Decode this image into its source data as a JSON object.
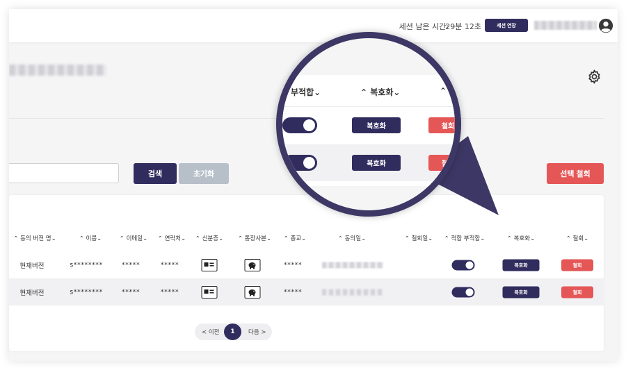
{
  "topbar": {
    "session_label": "세션 남은 시간:",
    "session_time": "29분 12초",
    "extend_label": "세션 연장",
    "user_icon": "user-icon"
  },
  "filters": {
    "search_placeholder": "",
    "search_label": "검색",
    "reset_label": "초기화",
    "bulk_withdraw_label": "선택 철회"
  },
  "table": {
    "headers": [
      "동의 버전 명",
      "이름",
      "이메일",
      "연락처",
      "신분증",
      "통장사본",
      "종교",
      "동의일",
      "철회일",
      "적합 부적합",
      "복호화",
      "철회"
    ],
    "rows": [
      {
        "version": "현재버전",
        "name": "s********",
        "email": "*****",
        "phone": "*****",
        "religion": "*****",
        "consent_on": true,
        "restore_label": "복호화",
        "withdraw_label": "철회"
      },
      {
        "version": "현재버전",
        "name": "s********",
        "email": "*****",
        "phone": "*****",
        "religion": "*****",
        "consent_on": true,
        "restore_label": "복호화",
        "withdraw_label": "철회"
      }
    ]
  },
  "pagination": {
    "prev_label": "< 이전",
    "page": "1",
    "next_label": "다음 >"
  },
  "magnifier": {
    "headers": [
      "부적합",
      "복호화"
    ],
    "restore_label": "복호화",
    "withdraw_label": "철회"
  },
  "colors": {
    "primary": "#302d5e",
    "danger": "#e55656",
    "muted": "#b7bfc9",
    "lens_border": "#3d3765"
  }
}
